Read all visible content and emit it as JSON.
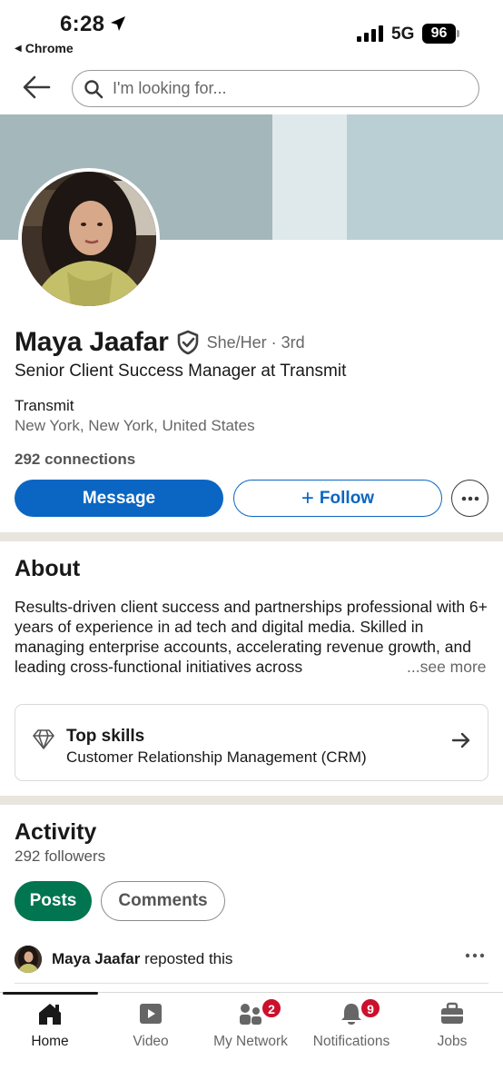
{
  "status_bar": {
    "time": "6:28",
    "back_app": "Chrome",
    "network": "5G",
    "battery": "96"
  },
  "search": {
    "placeholder": "I'm looking for..."
  },
  "profile": {
    "name": "Maya Jaafar",
    "pronouns_degree": "She/Her · 3rd",
    "headline": "Senior Client Success Manager at Transmit",
    "company": "Transmit",
    "location": "New York, New York, United States",
    "connections": "292 connections"
  },
  "actions": {
    "message": "Message",
    "follow": "Follow",
    "plus": "+"
  },
  "about": {
    "title": "About",
    "text": "Results-driven client success and partnerships professional with 6+ years of experience in ad tech and digital media. Skilled in managing enterprise accounts, accelerating revenue growth, and leading cross-functional initiatives across",
    "see_more": "...see more"
  },
  "top_skills": {
    "title": "Top skills",
    "value": "Customer Relationship Management (CRM)"
  },
  "activity": {
    "title": "Activity",
    "followers": "292 followers",
    "tabs": [
      "Posts",
      "Comments"
    ],
    "repost_name": "Maya Jaafar",
    "repost_suffix": " reposted this"
  },
  "bottom_nav": {
    "items": [
      {
        "label": "Home",
        "icon": "home-icon"
      },
      {
        "label": "Video",
        "icon": "video-icon"
      },
      {
        "label": "My Network",
        "icon": "network-icon",
        "badge": "2"
      },
      {
        "label": "Notifications",
        "icon": "bell-icon",
        "badge": "9"
      },
      {
        "label": "Jobs",
        "icon": "briefcase-icon"
      }
    ]
  },
  "colors": {
    "brand_blue": "#0a66c2",
    "posts_green": "#01754f",
    "badge_red": "#cb112d",
    "banner": "#b9cfd4"
  }
}
